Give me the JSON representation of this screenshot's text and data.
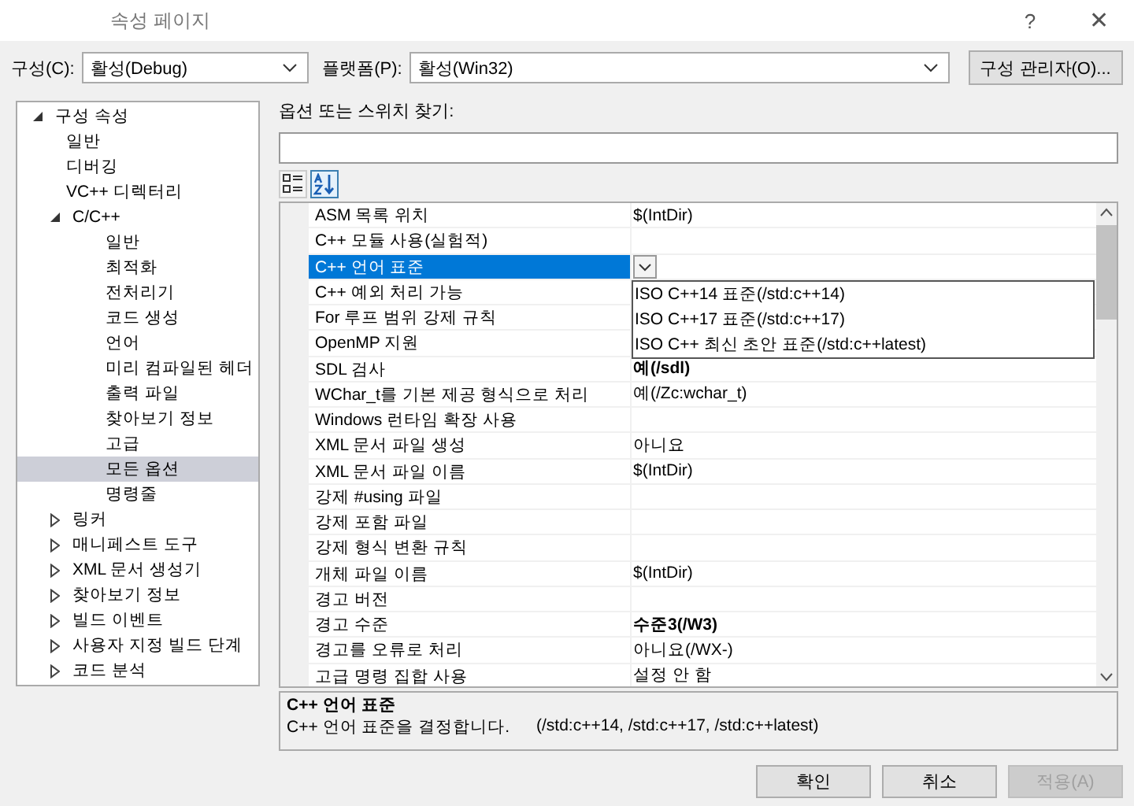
{
  "window": {
    "title": "속성 페이지",
    "help": "?",
    "close": "✕"
  },
  "config": {
    "label": "구성(C):",
    "value": "활성(Debug)"
  },
  "platform": {
    "label": "플랫폼(P):",
    "value": "활성(Win32)"
  },
  "config_manager_button": "구성 관리자(O)...",
  "tree": [
    {
      "label": "구성 속성",
      "expanded": true,
      "selected": false,
      "children": [
        {
          "label": "일반",
          "selected": false
        },
        {
          "label": "디버깅",
          "selected": false
        },
        {
          "label": "VC++ 디렉터리",
          "selected": false
        },
        {
          "label": "C/C++",
          "expanded": true,
          "selected": false,
          "children": [
            {
              "label": "일반",
              "selected": false
            },
            {
              "label": "최적화",
              "selected": false
            },
            {
              "label": "전처리기",
              "selected": false
            },
            {
              "label": "코드 생성",
              "selected": false
            },
            {
              "label": "언어",
              "selected": false
            },
            {
              "label": "미리 컴파일된 헤더",
              "selected": false
            },
            {
              "label": "출력 파일",
              "selected": false
            },
            {
              "label": "찾아보기 정보",
              "selected": false
            },
            {
              "label": "고급",
              "selected": false
            },
            {
              "label": "모든 옵션",
              "selected": true
            },
            {
              "label": "명령줄",
              "selected": false
            }
          ]
        },
        {
          "label": "링커",
          "expanded": false,
          "selected": false
        },
        {
          "label": "매니페스트 도구",
          "expanded": false,
          "selected": false
        },
        {
          "label": "XML 문서 생성기",
          "expanded": false,
          "selected": false
        },
        {
          "label": "찾아보기 정보",
          "expanded": false,
          "selected": false
        },
        {
          "label": "빌드 이벤트",
          "expanded": false,
          "selected": false
        },
        {
          "label": "사용자 지정 빌드 단계",
          "expanded": false,
          "selected": false
        },
        {
          "label": "코드 분석",
          "expanded": false,
          "selected": false
        }
      ]
    }
  ],
  "search": {
    "label": "옵션 또는 스위치 찾기:"
  },
  "view_buttons": [
    {
      "kind": "categorized",
      "selected": false
    },
    {
      "kind": "alphabetical",
      "selected": true
    }
  ],
  "properties": [
    {
      "name": "ASM 목록 위치",
      "value": "$(IntDir)",
      "modified": false,
      "selected": false
    },
    {
      "name": "C++ 모듈 사용(실험적)",
      "modified": false,
      "selected": false
    },
    {
      "name": "C++ 언어 표준",
      "modified": false,
      "selected": true
    },
    {
      "name": "C++ 예외 처리 가능",
      "modified": false,
      "selected": false
    },
    {
      "name": "For 루프 범위 강제 규칙",
      "modified": false,
      "selected": false
    },
    {
      "name": "OpenMP 지원",
      "modified": false,
      "selected": false
    },
    {
      "name": "SDL 검사",
      "value": "예(/sdl)",
      "modified": true,
      "selected": false
    },
    {
      "name": "WChar_t를 기본 제공 형식으로 처리",
      "value": "예(/Zc:wchar_t)",
      "modified": false,
      "selected": false
    },
    {
      "name": "Windows 런타임 확장 사용",
      "modified": false,
      "selected": false
    },
    {
      "name": "XML 문서 파일 생성",
      "value": "아니요",
      "modified": false,
      "selected": false
    },
    {
      "name": "XML 문서 파일 이름",
      "value": "$(IntDir)",
      "modified": false,
      "selected": false
    },
    {
      "name": "강제 #using 파일",
      "modified": false,
      "selected": false
    },
    {
      "name": "강제 포함 파일",
      "modified": false,
      "selected": false
    },
    {
      "name": "강제 형식 변환 규칙",
      "modified": false,
      "selected": false
    },
    {
      "name": "개체 파일 이름",
      "value": "$(IntDir)",
      "modified": false,
      "selected": false
    },
    {
      "name": "경고 버전",
      "modified": false,
      "selected": false
    },
    {
      "name": "경고 수준",
      "value": "수준3(/W3)",
      "modified": true,
      "selected": false
    },
    {
      "name": "경고를 오류로 처리",
      "value": "아니요(/WX-)",
      "modified": false,
      "selected": false
    },
    {
      "name": "고급 명령 집합 사용",
      "value": "설정 안 함",
      "modified": false,
      "selected": false
    }
  ],
  "dropdown_options": [
    "ISO C++14 표준(/std:c++14)",
    "ISO C++17 표준(/std:c++17)",
    "ISO C++ 최신 초안 표준(/std:c++latest)"
  ],
  "description": {
    "title": "C++ 언어 표준",
    "text": "C++ 언어 표준을 결정합니다.",
    "switches": "(/std:c++14, /std:c++17, /std:c++latest)"
  },
  "buttons": [
    {
      "label": "확인",
      "disabled": false
    },
    {
      "label": "취소",
      "disabled": false
    },
    {
      "label": "적용(A)",
      "disabled": true
    }
  ]
}
